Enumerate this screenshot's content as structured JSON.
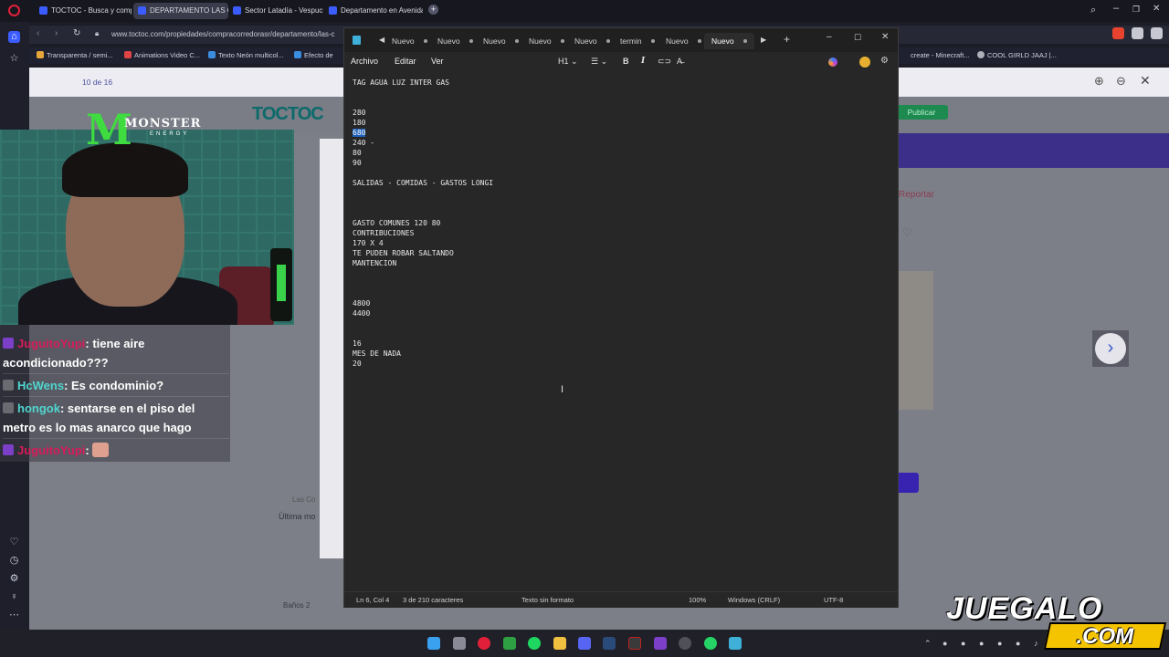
{
  "browser": {
    "tabs": [
      {
        "label": "TOCTOC - Busca y compra"
      },
      {
        "label": "DEPARTAMENTO LAS CO"
      },
      {
        "label": "Sector Latadía - Vespucio"
      },
      {
        "label": "Departamento en Avenida"
      }
    ],
    "url": "www.toctoc.com/propiedades/compracorredorasr/departamento/las-c",
    "bookmarks": [
      {
        "label": "Transparenta / semi..."
      },
      {
        "label": "Animations Video C..."
      },
      {
        "label": "Texto Neón multicol..."
      },
      {
        "label": "Efecto de"
      },
      {
        "label": "create - Minecraft..."
      },
      {
        "label": "COOL GIRLD JAAJ |..."
      }
    ]
  },
  "site": {
    "page_counter": "10 de 16",
    "logo": "TOCTOC",
    "publicar": "Publicar",
    "reportar": "Reportar",
    "ultima": "Última mo",
    "las_condes": "Las Co",
    "banos": "Baños  2"
  },
  "webcam": {
    "brand_top": "MONSTER",
    "brand_bottom": "ENERGY"
  },
  "chat": {
    "messages": [
      {
        "user": "JuguitoYupi",
        "text": ": tiene aire acondicionado???"
      },
      {
        "user": "HcWens",
        "text": ": Es condominio?"
      },
      {
        "user": "hongok",
        "text": ": sentarse en el piso del metro es lo mas anarco que hago"
      },
      {
        "user": "JuguitoYupi",
        "text": ":"
      }
    ]
  },
  "notepad": {
    "tabs": [
      "Nuevo",
      "Nuevo",
      "Nuevo",
      "Nuevo",
      "Nuevo",
      "termin",
      "Nuevo",
      "Nuevo"
    ],
    "menu": {
      "archivo": "Archivo",
      "editar": "Editar",
      "ver": "Ver"
    },
    "heading_selector": "H1",
    "lines": [
      {
        "text": "TAG AGUA LUZ INTER GAS"
      },
      {
        "text": "280"
      },
      {
        "text": "180"
      },
      {
        "text": "680",
        "selected": true
      },
      {
        "text": "240 -"
      },
      {
        "text": "80"
      },
      {
        "text": "90"
      },
      {
        "text": "SALIDAS - COMIDAS - GASTOS LONGI"
      },
      {
        "text": "GASTO COMUNES 120 80"
      },
      {
        "text": "CONTRIBUCIONES"
      },
      {
        "text": "170 X 4"
      },
      {
        "text": "TE PUDEN ROBAR SALTANDO"
      },
      {
        "text": "MANTENCION"
      },
      {
        "text": "4800"
      },
      {
        "text": "4400"
      },
      {
        "text": "16"
      },
      {
        "text": "MES DE NADA"
      },
      {
        "text": "20"
      }
    ],
    "status": {
      "position": "Ln 6, Col 4",
      "chars": "3 de 210 caracteres",
      "format": "Texto sin formato",
      "zoom": "100%",
      "eol": "Windows (CRLF)",
      "encoding": "UTF-8"
    }
  },
  "watermark": {
    "top": "JUEGALO",
    "bottom": ".COM"
  }
}
